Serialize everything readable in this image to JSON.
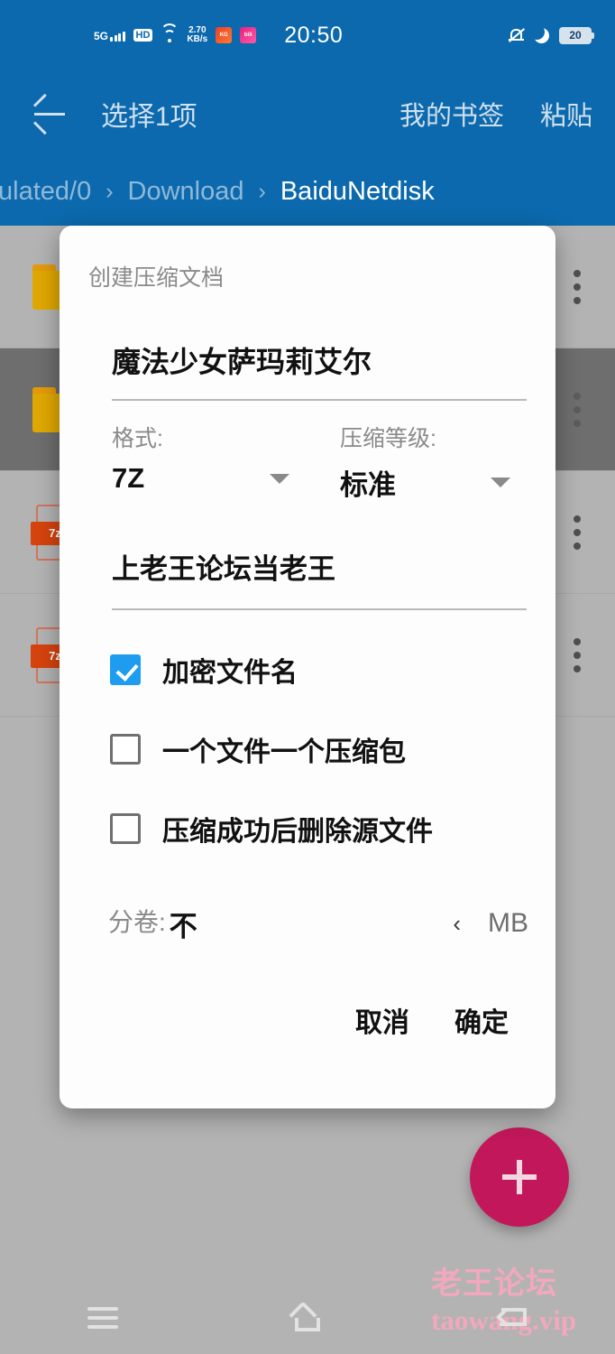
{
  "status_bar": {
    "network_label": "5G",
    "hd_label": "HD",
    "speed_value": "2.70",
    "speed_unit": "KB/s",
    "app_icon_1": "kugou-app-icon",
    "app_icon_2": "bilibili-app-icon",
    "time": "20:50",
    "battery_level": "20",
    "silent_icon": "bell-muted-icon",
    "dnd_icon": "moon-icon"
  },
  "appbar": {
    "back_icon": "back-arrow-icon",
    "selection_title": "选择1项",
    "actions": [
      "我的书签",
      "粘贴"
    ],
    "breadcrumb": {
      "separator": "›",
      "items": [
        "ulated/0",
        "Download",
        "BaiduNetdisk"
      ]
    }
  },
  "filelist": {
    "rows": [
      {
        "icon": "folder-icon",
        "selected": false,
        "overflow": "more-vertical-icon"
      },
      {
        "icon": "folder-icon",
        "selected": true,
        "overflow": "more-vertical-icon"
      },
      {
        "icon": "archive-7z-icon",
        "selected": false,
        "overflow": "more-vertical-icon"
      },
      {
        "icon": "archive-7z-icon",
        "selected": false,
        "overflow": "more-vertical-icon"
      }
    ]
  },
  "dialog": {
    "title": "创建压缩文档",
    "filename_value": "魔法少女萨玛莉艾尔",
    "format": {
      "label": "格式:",
      "value": "7Z",
      "caret_icon": "chevron-down-icon"
    },
    "level": {
      "label": "压缩等级:",
      "value": "标准",
      "caret_icon": "chevron-down-icon"
    },
    "password_value": "上老王论坛当老王",
    "checkboxes": [
      {
        "label": "加密文件名",
        "checked": true
      },
      {
        "label": "一个文件一个压缩包",
        "checked": false
      },
      {
        "label": "压缩成功后删除源文件",
        "checked": false
      }
    ],
    "split": {
      "label": "分卷:",
      "value": "不",
      "chevron_icon": "chevron-left-icon",
      "unit": "MB"
    },
    "cancel_label": "取消",
    "confirm_label": "确定"
  },
  "fab": {
    "icon": "plus-icon",
    "color": "#c2185b"
  },
  "watermark": {
    "line1": "老王论坛",
    "line2": "taowang.vip",
    "color": "#f2a8bd"
  },
  "navbar": {
    "recents_icon": "recents-icon",
    "home_icon": "home-icon",
    "back_icon": "back-icon"
  },
  "colors": {
    "appbar_blue": "#0c69ad",
    "accent_checkbox": "#1e9cf0",
    "fab_pink": "#c2185b",
    "background_gray": "#b3b3b3",
    "selected_row": "#6e6e6e"
  }
}
